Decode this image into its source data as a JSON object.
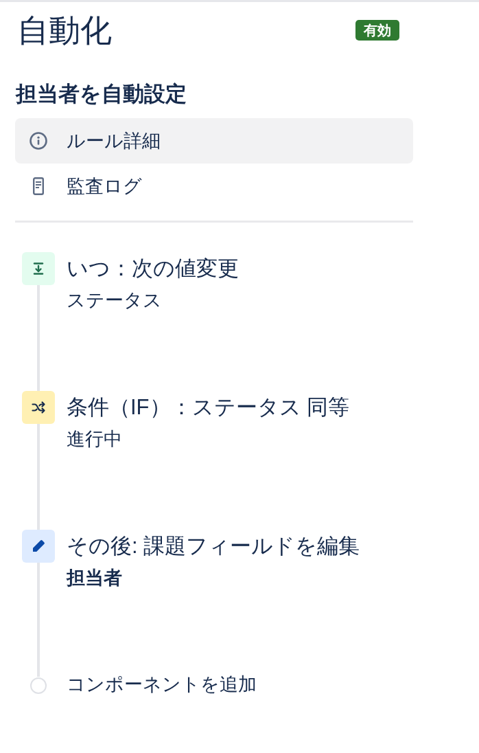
{
  "page": {
    "title": "自動化",
    "badge": {
      "label": "有効",
      "kind": "success"
    }
  },
  "rule": {
    "name": "担当者を自動設定"
  },
  "nav": [
    {
      "label": "ルール詳細",
      "kind": "info",
      "selected": true
    },
    {
      "label": "監査ログ",
      "kind": "log",
      "selected": false
    }
  ],
  "steps": [
    {
      "kind": "trigger",
      "title": "いつ：次の値変更",
      "value": "ステータス",
      "value_bold": false
    },
    {
      "kind": "condition",
      "title": "条件（IF）：ステータス 同等",
      "value": "進行中",
      "value_bold": false
    },
    {
      "kind": "action",
      "title": "その後: 課題フィールドを編集",
      "value": "担当者",
      "value_bold": true
    }
  ],
  "add_component": {
    "label": "コンポーネントを追加"
  }
}
